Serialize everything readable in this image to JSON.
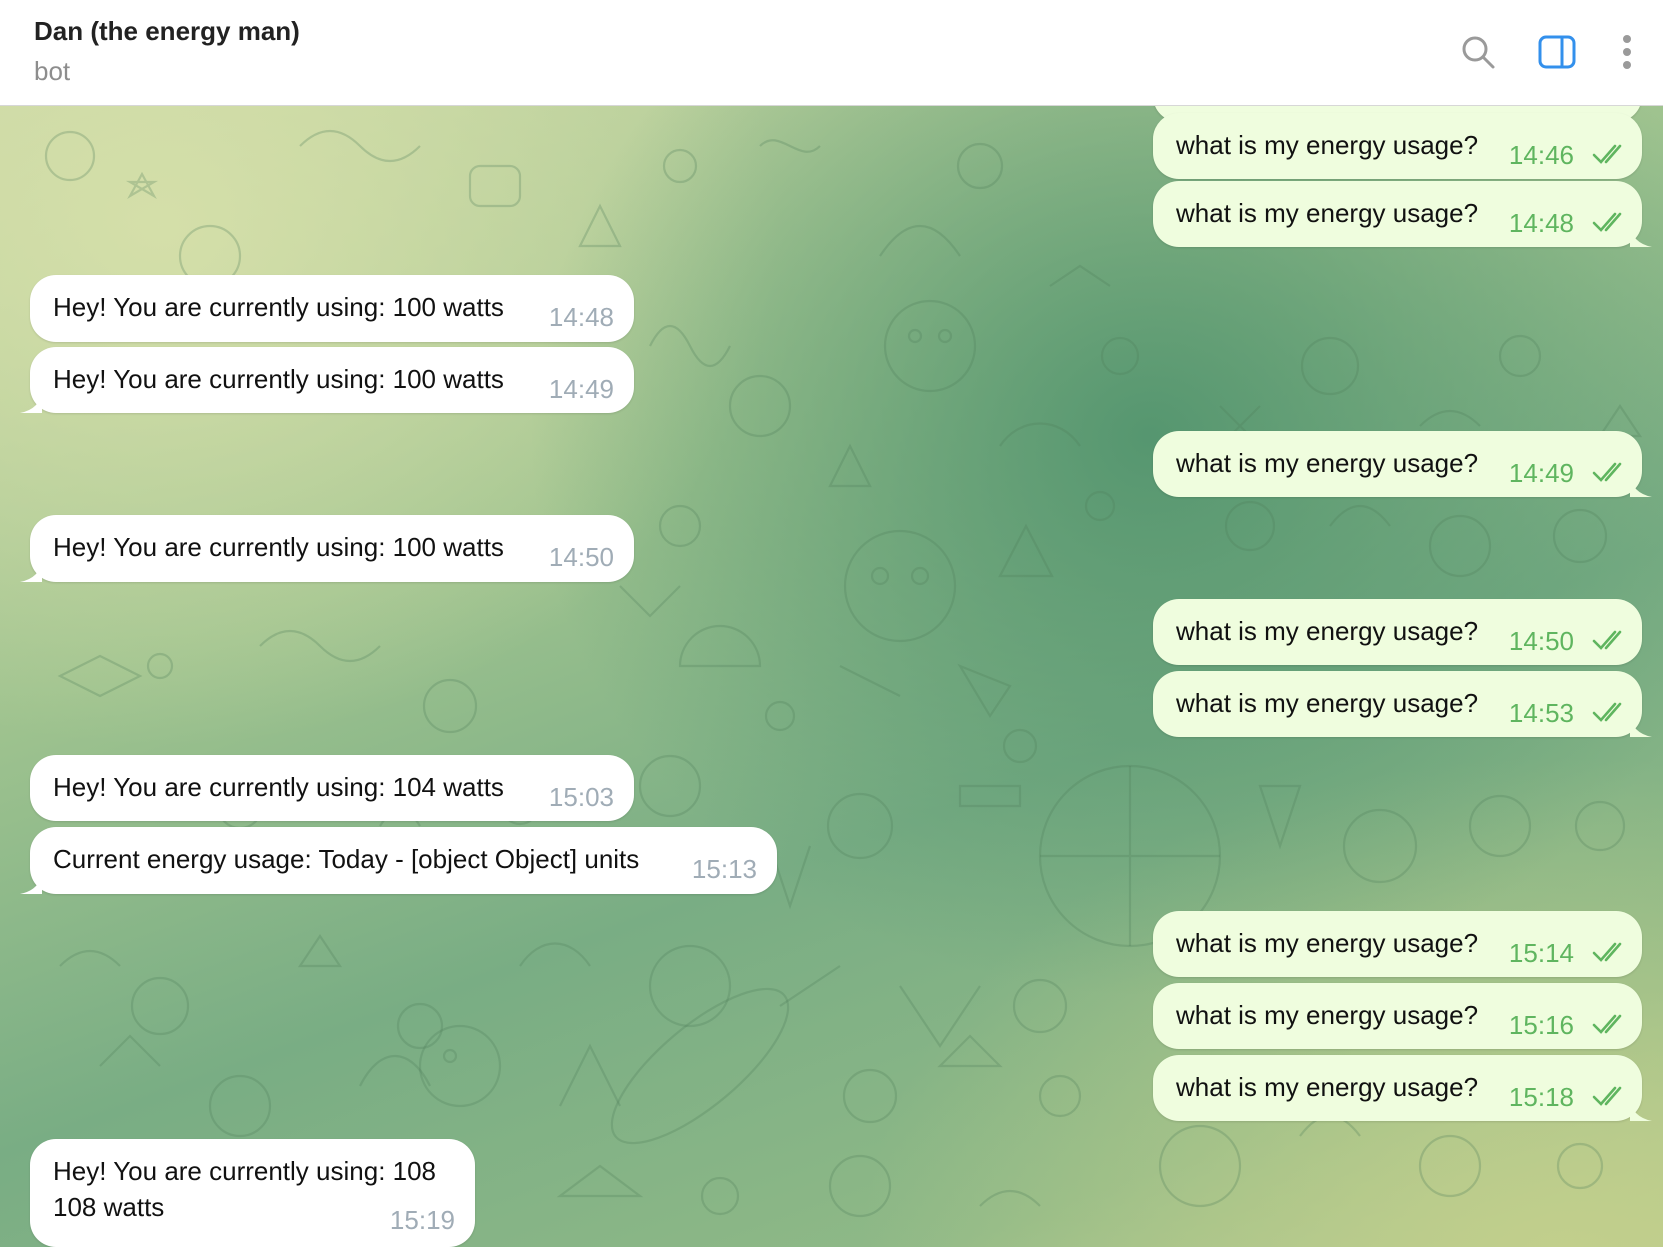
{
  "header": {
    "title": "Dan (the energy man)",
    "status": "bot"
  },
  "icons": {
    "search": "search-icon",
    "sidebar": "sidebar-toggle-icon",
    "more": "more-vertical-icon"
  },
  "colors": {
    "outgoing_bubble": "#effdde",
    "incoming_bubble": "#ffffff",
    "outgoing_time": "#5fb55f",
    "incoming_time": "#a0acb6",
    "accent": "#3390ec"
  },
  "messages": {
    "out": [
      {
        "text": "what is my energy usage?",
        "time": "14:46"
      },
      {
        "text": "what is my energy usage?",
        "time": "14:48"
      },
      {
        "text": "what is my energy usage?",
        "time": "14:49"
      },
      {
        "text": "what is my energy usage?",
        "time": "14:50"
      },
      {
        "text": "what is my energy usage?",
        "time": "14:53"
      },
      {
        "text": "what is my energy usage?",
        "time": "15:14"
      },
      {
        "text": "what is my energy usage?",
        "time": "15:16"
      },
      {
        "text": "what is my energy usage?",
        "time": "15:18"
      }
    ],
    "in": [
      {
        "text": "Hey! You are currently using: 100 watts",
        "time": "14:48"
      },
      {
        "text": "Hey! You are currently using: 100 watts",
        "time": "14:49"
      },
      {
        "text": "Hey! You are currently using: 100 watts",
        "time": "14:50"
      },
      {
        "text": "Hey! You are currently using: 104 watts",
        "time": "15:03"
      },
      {
        "text": "Current energy usage: Today - [object Object] units",
        "time": "15:13"
      },
      {
        "lines": [
          "Hey! You are currently using: 108",
          "108 watts"
        ],
        "time": "15:19"
      }
    ]
  }
}
